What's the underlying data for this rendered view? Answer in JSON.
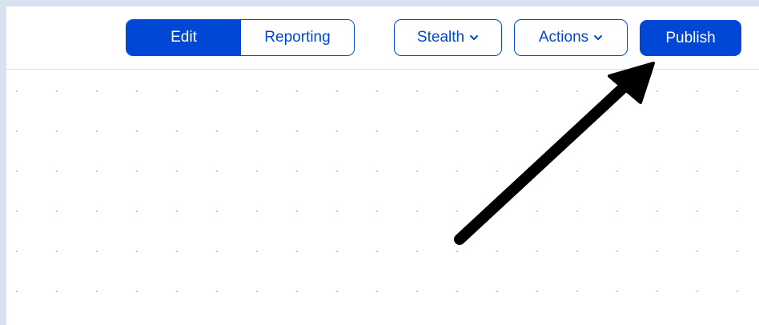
{
  "toolbar": {
    "view_toggle": {
      "edit_label": "Edit",
      "reporting_label": "Reporting"
    },
    "stealth_label": "Stealth",
    "actions_label": "Actions",
    "publish_label": "Publish"
  },
  "icons": {
    "dropdown": "chevron-down-icon",
    "annotation": "arrow-icon"
  },
  "colors": {
    "accent": "#0047d6",
    "page_background": "#d6e3ee",
    "canvas_dot": "#c4c4c4",
    "annotation_arrow": "#000000"
  }
}
